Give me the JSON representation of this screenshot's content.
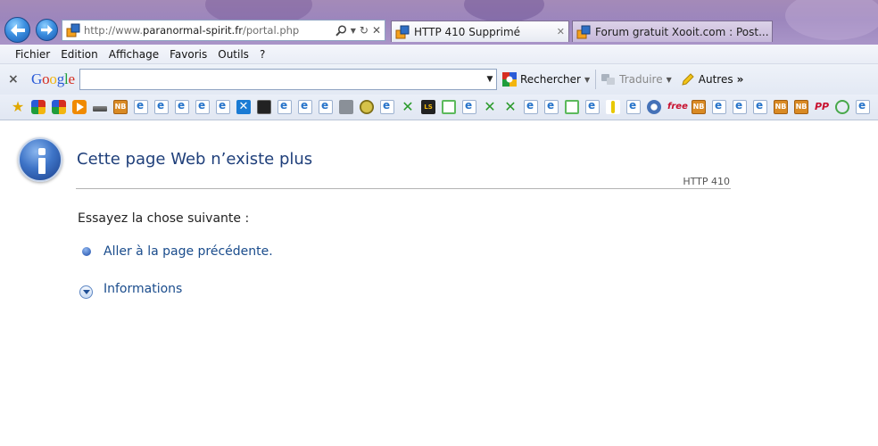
{
  "browser": {
    "address_url_prefix": "http://www.",
    "address_url_domain": "paranormal-spirit.fr",
    "address_url_path": "/portal.php",
    "tabs": [
      {
        "title": "HTTP 410 Supprimé",
        "active": true
      },
      {
        "title": "Forum gratuit Xooit.com : Post...",
        "active": false
      }
    ]
  },
  "menubar": {
    "items": [
      "Fichier",
      "Edition",
      "Affichage",
      "Favoris",
      "Outils",
      "?"
    ]
  },
  "google_toolbar": {
    "logo": "Google",
    "search_value": "",
    "search_button": "Rechercher",
    "translate_button": "Traduire",
    "more_button": "Autres",
    "more_chevron": "»"
  },
  "favorites_bar": {
    "icons": [
      "favorites-star-icon",
      "google-icon",
      "google-icon",
      "play-icon",
      "gun-icon",
      "nb-icon",
      "ie-page-icon",
      "ie-page-icon",
      "ie-page-icon",
      "ie-page-icon",
      "ie-page-icon",
      "x-icon",
      "dark-icon",
      "ie-page-icon",
      "ie-page-icon",
      "ie-page-icon",
      "tv-icon",
      "coin-icon",
      "ie-page-icon",
      "xgreen-icon",
      "ls-icon",
      "green-page-icon",
      "ie-page-icon",
      "xgreen-icon",
      "xgreen-icon",
      "ie-page-icon",
      "ie-page-icon",
      "green-page-icon",
      "ie-page-icon",
      "yellow-bar-icon",
      "ie-page-icon",
      "badge-icon",
      "free-icon",
      "nb-icon",
      "ie-page-icon",
      "ie-page-icon",
      "ie-page-icon",
      "nb-icon",
      "nb-icon",
      "pp-icon",
      "circle-icon",
      "ie-page-icon"
    ],
    "free_label": "free",
    "pp_label": "PP",
    "nb_label": "NB",
    "ls_label": "LS"
  },
  "page": {
    "title": "Cette page Web n’existe plus",
    "http_code": "HTTP 410",
    "try_label": "Essayez la chose suivante :",
    "back_link": "Aller à la page précédente.",
    "info_link": "Informations"
  },
  "colors": {
    "title_blue": "#1f3f7a",
    "link_blue": "#1a4c8c",
    "chrome_purple": "#a48ab8"
  }
}
